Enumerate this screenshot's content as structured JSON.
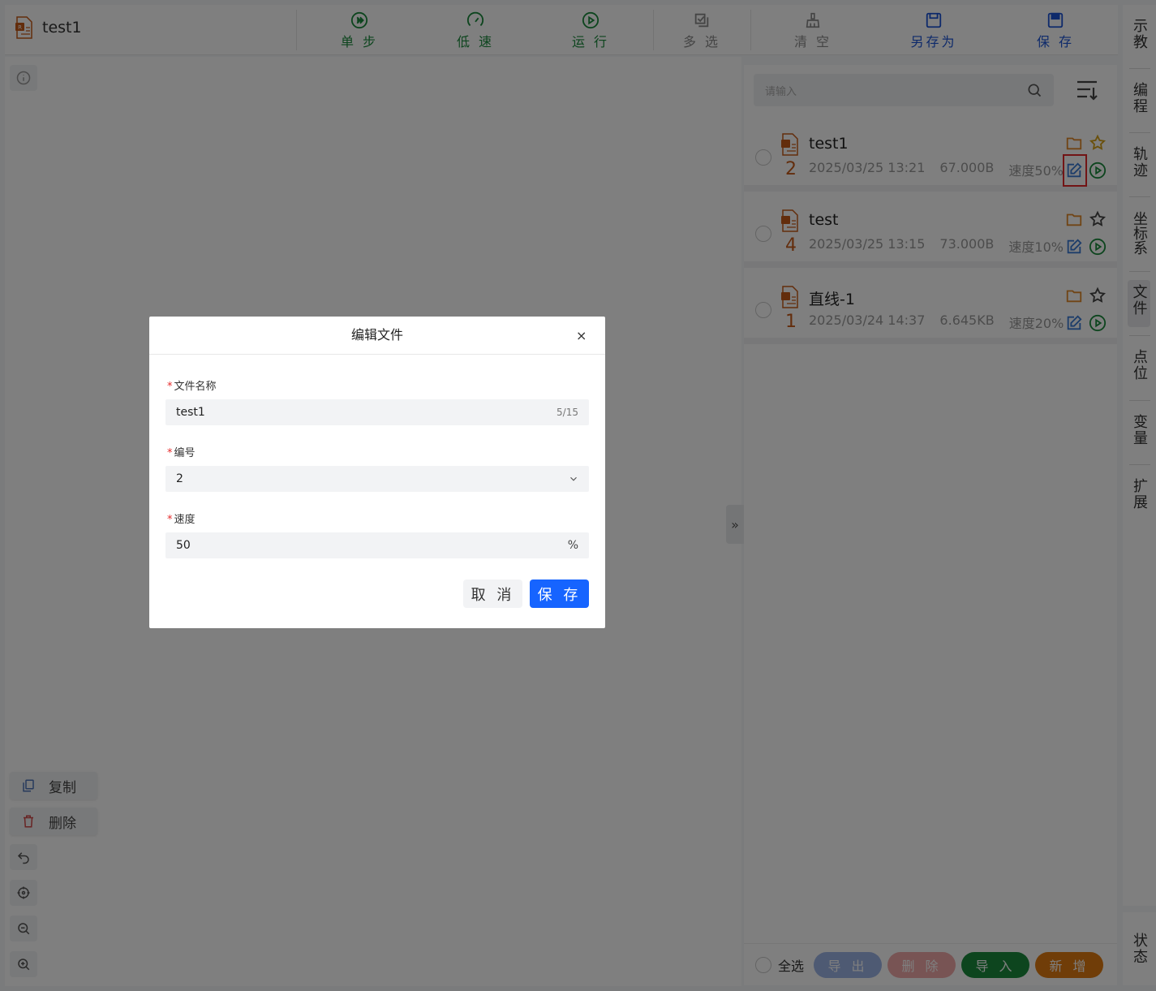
{
  "header": {
    "file_title": "test1",
    "toolbar": [
      {
        "label": "单 步",
        "icon": "step-icon",
        "color": "#1a8a3c"
      },
      {
        "label": "低 速",
        "icon": "low-speed-icon",
        "color": "#1a8a3c"
      },
      {
        "label": "运 行",
        "icon": "run-icon",
        "color": "#1a8a3c"
      },
      {
        "label": "多 选",
        "icon": "multi-select-icon",
        "color": "#8a8a8a"
      },
      {
        "label": "清 空",
        "icon": "broom-icon",
        "color": "#8a8a8a"
      },
      {
        "label": "另存为",
        "icon": "save-as-icon",
        "color": "#1c55d6"
      },
      {
        "label": "保 存",
        "icon": "save-icon",
        "color": "#1c55d6"
      }
    ]
  },
  "canvas": {
    "copy_label": "复制",
    "delete_label": "删除"
  },
  "file_panel": {
    "search_placeholder": "请输入",
    "files": [
      {
        "number": "2",
        "name": "test1",
        "date": "2025/03/25 13:21",
        "size": "67.000B",
        "speed": "速度50%"
      },
      {
        "number": "4",
        "name": "test",
        "date": "2025/03/25 13:15",
        "size": "73.000B",
        "speed": "速度10%"
      },
      {
        "number": "1",
        "name": "直线-1",
        "date": "2025/03/24 14:37",
        "size": "6.645KB",
        "speed": "速度20%"
      }
    ],
    "select_all": "全选",
    "actions": [
      {
        "label": "导 出",
        "color": "#9db5e6"
      },
      {
        "label": "删 除",
        "color": "#f0a8a8"
      },
      {
        "label": "导 入",
        "color": "#1a8a3c"
      },
      {
        "label": "新 增",
        "color": "#e07a10"
      }
    ]
  },
  "right_nav": {
    "items": [
      "示教",
      "编程",
      "轨迹",
      "坐标系",
      "文件",
      "点位",
      "变量",
      "扩展"
    ],
    "active": "文件",
    "status": "状态"
  },
  "modal": {
    "title": "编辑文件",
    "close": "×",
    "fields": {
      "name_label": "文件名称",
      "name_value": "test1",
      "name_counter": "5/15",
      "number_label": "编号",
      "number_value": "2",
      "speed_label": "速度",
      "speed_value": "50",
      "speed_unit": "%"
    },
    "cancel_label": "取 消",
    "save_label": "保 存"
  }
}
